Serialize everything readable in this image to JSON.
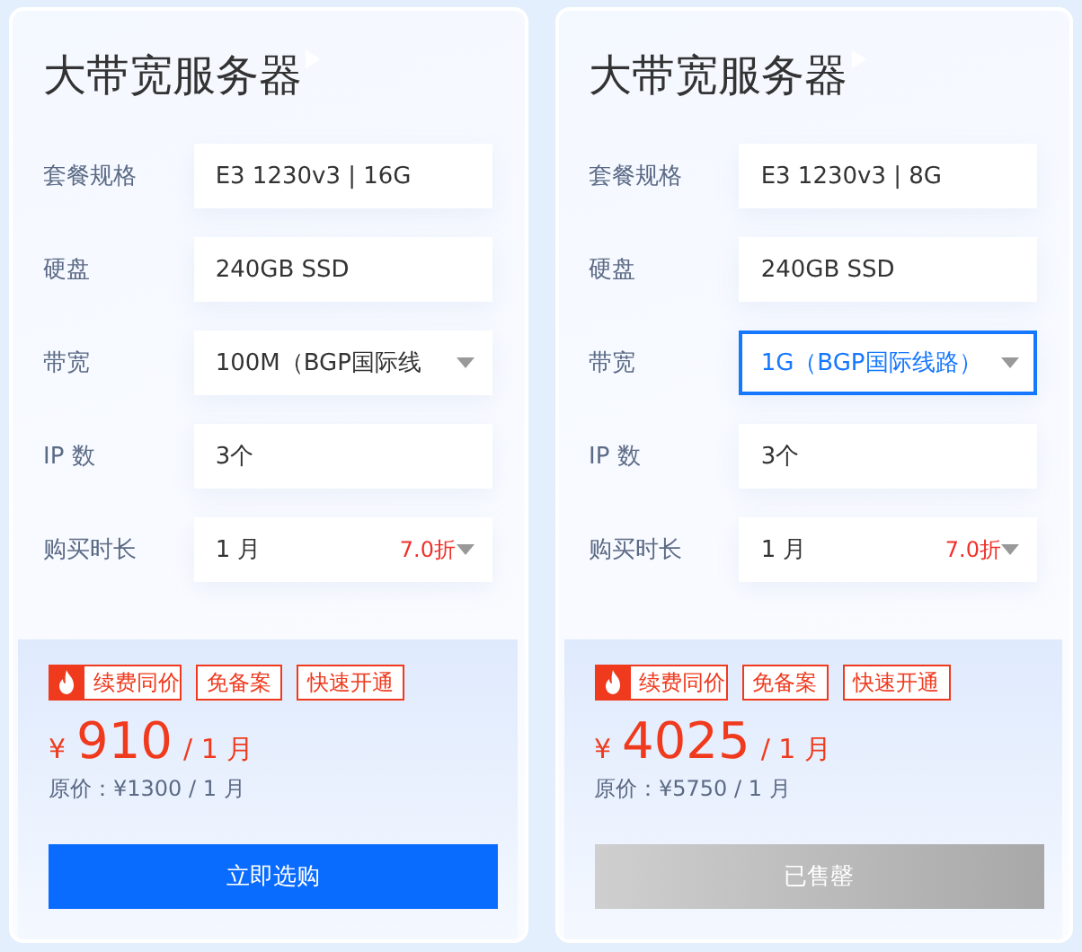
{
  "cards": [
    {
      "title": "大带宽服务器",
      "fields": [
        {
          "label": "套餐规格",
          "kind": "text",
          "value": "E3 1230v3 | 16G"
        },
        {
          "label": "硬盘",
          "kind": "text",
          "value": "240GB SSD"
        },
        {
          "label": "带宽",
          "kind": "select",
          "value": "100M（BGP国际线",
          "focused": false
        },
        {
          "label": "IP 数",
          "kind": "text",
          "value": "3个"
        },
        {
          "label": "购买时长",
          "kind": "select",
          "value": "1 月",
          "discount": "7.0折",
          "focused": false
        }
      ],
      "tags": [
        {
          "label": "续费同价",
          "kind": "hot"
        },
        {
          "label": "免备案",
          "kind": "plain"
        },
        {
          "label": "快速开通",
          "kind": "plain"
        }
      ],
      "currency": "¥",
      "price": "910",
      "period": "/ 1 月",
      "original_price": "原价：¥1300 / 1 月",
      "button": {
        "label": "立即选购",
        "disabled": false
      }
    },
    {
      "title": "大带宽服务器",
      "fields": [
        {
          "label": "套餐规格",
          "kind": "text",
          "value": "E3 1230v3 | 8G"
        },
        {
          "label": "硬盘",
          "kind": "text",
          "value": "240GB SSD"
        },
        {
          "label": "带宽",
          "kind": "select",
          "value": "1G（BGP国际线路）",
          "focused": true
        },
        {
          "label": "IP 数",
          "kind": "text",
          "value": "3个"
        },
        {
          "label": "购买时长",
          "kind": "select",
          "value": "1 月",
          "discount": "7.0折",
          "focused": false
        }
      ],
      "tags": [
        {
          "label": "续费同价",
          "kind": "hot"
        },
        {
          "label": "免备案",
          "kind": "plain"
        },
        {
          "label": "快速开通",
          "kind": "plain"
        }
      ],
      "currency": "¥",
      "price": "4025",
      "period": "/ 1 月",
      "original_price": "原价：¥5750 / 1 月",
      "button": {
        "label": "已售罄",
        "disabled": true
      }
    }
  ]
}
